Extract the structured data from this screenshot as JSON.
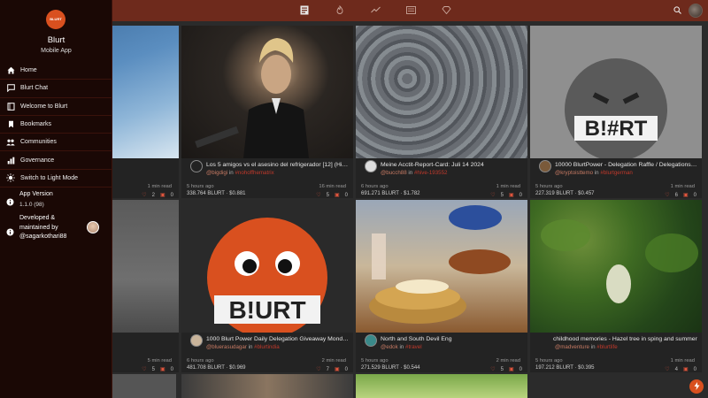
{
  "drawer": {
    "brand": "Blurt",
    "brand_sub": "Mobile App",
    "logo_text": "BLURT",
    "items": [
      {
        "label": "Home",
        "icon": "home-icon"
      },
      {
        "label": "Blurt Chat",
        "icon": "chat-icon"
      },
      {
        "label": "Welcome to Blurt",
        "icon": "book-icon"
      },
      {
        "label": "Bookmarks",
        "icon": "bookmark-icon"
      },
      {
        "label": "Communities",
        "icon": "people-icon"
      },
      {
        "label": "Governance",
        "icon": "bar-chart-icon"
      },
      {
        "label": "Switch to Light Mode",
        "icon": "sun-icon"
      }
    ],
    "version_label": "App Version",
    "version_value": "1.1.0 (98)",
    "developer_text": "Developed & maintained by @sagarkothari88"
  },
  "topbar": {
    "icons": [
      "feed-icon",
      "hot-icon",
      "trending-icon",
      "news-icon",
      "promoted-icon",
      "search-icon"
    ]
  },
  "cards": [
    {
      "title": "",
      "author": "",
      "tag": "",
      "time": "",
      "read": "1 min read",
      "stats": "",
      "likes": "2",
      "comments": "0"
    },
    {
      "title": "Los 5 amigos vs el asesino del refrigerador [12] (Historia...",
      "author": "@bigdigi",
      "tag": "#nohoffhematrix",
      "time": "5 hours ago",
      "read": "16 min read",
      "stats": "338.764 BLURT · $0.881",
      "likes": "5",
      "comments": "0"
    },
    {
      "title": "Meine Acctit-Report-Card: Juli 14 2024",
      "author": "@bucch88",
      "tag": "#hive-193552",
      "time": "6 hours ago",
      "read": "1 min read",
      "stats": "691.271 BLURT · $1.782",
      "likes": "5",
      "comments": "0"
    },
    {
      "title": "10000 BlurtPower - Delegation Raffle / Delegationsverlose...",
      "author": "@kryptoisttemo",
      "tag": "#blurtgerman",
      "time": "5 hours ago",
      "read": "1 min read",
      "stats": "227.319 BLURT · $0.457",
      "likes": "6",
      "comments": "0"
    },
    {
      "title": "",
      "author": "",
      "tag": "",
      "time": "",
      "read": "5 min read",
      "stats": "",
      "likes": "5",
      "comments": "0"
    },
    {
      "title": "1000 Blurt Power Daily Delegation Giveaway Monday, 15...",
      "author": "@bluerasudagar",
      "tag": "#blurtindia",
      "time": "6 hours ago",
      "read": "2 min read",
      "stats": "481.708 BLURT · $0.969",
      "likes": "7",
      "comments": "0"
    },
    {
      "title": "North and South Devil Eng",
      "author": "@edok",
      "tag": "#travel",
      "time": "5 hours ago",
      "read": "2 min read",
      "stats": "271.529 BLURT · $0.544",
      "likes": "5",
      "comments": "0"
    },
    {
      "title": "childhood memories - Hazel tree in sping and summer",
      "author": "@madventure",
      "tag": "#blurtlife",
      "time": "5 hours ago",
      "read": "1 min read",
      "stats": "197.212 BLURT · $0.395",
      "likes": "4",
      "comments": "0"
    }
  ]
}
